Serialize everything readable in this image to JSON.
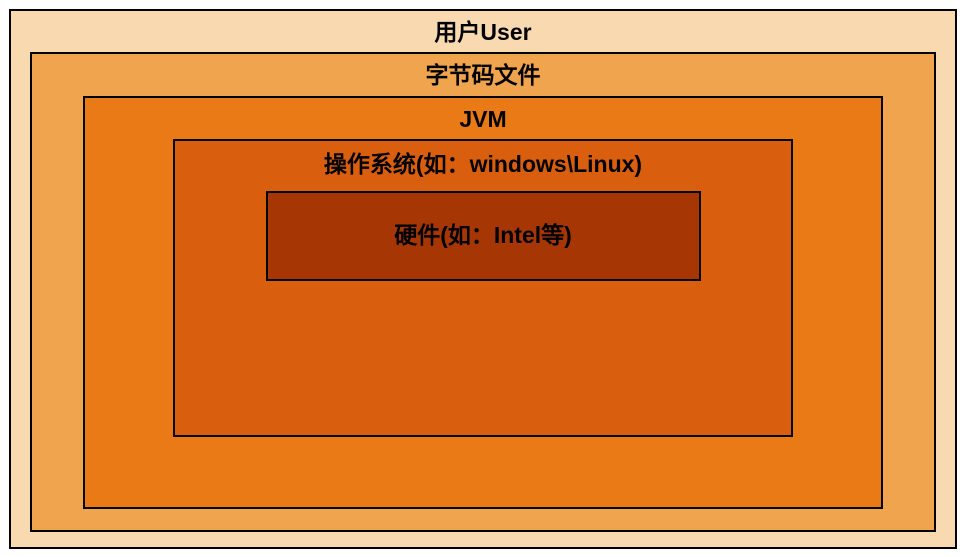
{
  "layers": {
    "user": "用户User",
    "bytecode": "字节码文件",
    "jvm": "JVM",
    "os": "操作系统(如：windows\\Linux)",
    "hardware": "硬件(如：Intel等)"
  }
}
